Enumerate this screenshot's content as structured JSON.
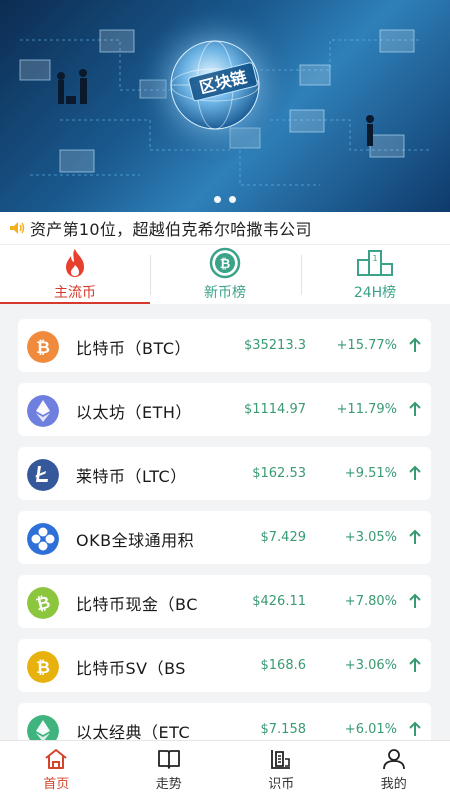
{
  "banner": {
    "globe_label": "区块链",
    "slides": 2
  },
  "ticker": {
    "text": "资产第10位，超越伯克希尔哈撒韦公司",
    "icon": "speaker-icon"
  },
  "tabs": [
    {
      "label": "主流币",
      "icon": "flame-icon",
      "active": true
    },
    {
      "label": "新币榜",
      "icon": "bitcoin-circle-icon",
      "active": false
    },
    {
      "label": "24H榜",
      "icon": "podium-icon",
      "active": false
    }
  ],
  "coins": [
    {
      "name": "比特币（BTC）",
      "price": "$35213.3",
      "change": "+15.77%",
      "icon": "bitcoin-icon",
      "color": "#f08a3c"
    },
    {
      "name": "以太坊（ETH）",
      "price": "$1114.97",
      "change": "+11.79%",
      "icon": "ethereum-icon",
      "color": "#6f7fe0"
    },
    {
      "name": "莱特币（LTC）",
      "price": "$162.53",
      "change": "+9.51%",
      "icon": "litecoin-icon",
      "color": "#34589a"
    },
    {
      "name": "OKB全球通用积",
      "price": "$7.429",
      "change": "+3.05%",
      "icon": "okb-icon",
      "color": "#2f6fd8"
    },
    {
      "name": "比特币现金（BC",
      "price": "$426.11",
      "change": "+7.80%",
      "icon": "bitcoin-cash-icon",
      "color": "#8cc63f"
    },
    {
      "name": "比特币SV（BS",
      "price": "$168.6",
      "change": "+3.06%",
      "icon": "bitcoin-sv-icon",
      "color": "#e8b20e"
    },
    {
      "name": "以太经典（ETC",
      "price": "$7.158",
      "change": "+6.01%",
      "icon": "ethereum-classic-icon",
      "color": "#3fb47e"
    }
  ],
  "nav": [
    {
      "label": "首页",
      "icon": "home-icon",
      "active": true
    },
    {
      "label": "走势",
      "icon": "book-icon",
      "active": false
    },
    {
      "label": "识币",
      "icon": "coin-info-icon",
      "active": false
    },
    {
      "label": "我的",
      "icon": "user-icon",
      "active": false
    }
  ],
  "colors": {
    "accent_red": "#d63a2c",
    "up_green": "#3a9a72",
    "tab_green": "#3aa38a"
  }
}
